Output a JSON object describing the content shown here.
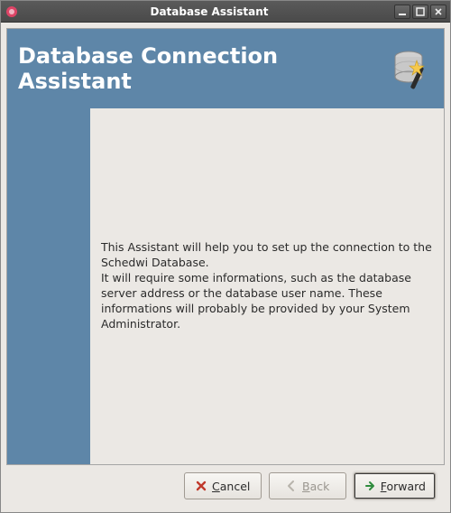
{
  "window": {
    "title": "Database Assistant"
  },
  "header": {
    "heading": "Database Connection Assistant"
  },
  "body": {
    "paragraph1": "This Assistant will help you to set up the connection to the Schedwi Database.",
    "paragraph2": "It will require some informations, such as the database server address or the database user name.  These informations will probably be provided by your System Administrator."
  },
  "buttons": {
    "cancel": "Cancel",
    "back": "Back",
    "forward": "Forward"
  },
  "icons": {
    "app": "database-assistant-icon",
    "wizard": "database-wizard-icon",
    "cancel": "cancel-icon",
    "back": "back-arrow-icon",
    "forward": "forward-arrow-icon",
    "minimize": "minimize-icon",
    "maximize": "maximize-icon",
    "close": "close-icon"
  },
  "colors": {
    "accent": "#5e86a8",
    "window_bg": "#ebe8e4"
  }
}
